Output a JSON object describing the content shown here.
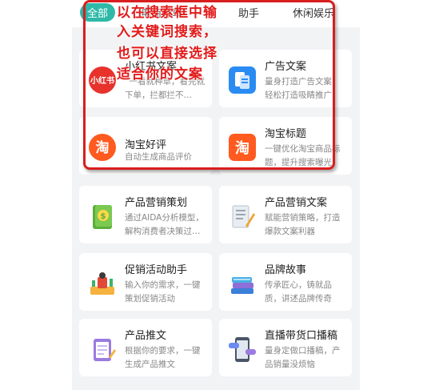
{
  "tabs": [
    {
      "label": "全部",
      "active": true
    },
    {
      "label": "电商种草",
      "active": false
    },
    {
      "label": "助手",
      "active": false
    },
    {
      "label": "休闲娱乐",
      "active": false
    }
  ],
  "annotation": {
    "lines": [
      "以在搜索框中输",
      "入关键词搜索，",
      "也可以直接选择",
      "适合你的文案"
    ]
  },
  "cards": [
    {
      "title": "小红书文案",
      "desc": "“一看就种草，看完就下单，拦都拦不…",
      "icon": "xiaohongshu-icon",
      "icon_text": "小红书"
    },
    {
      "title": "广告文案",
      "desc": "量身打造广告文案，轻松打造吸睛推广",
      "icon": "document-icon"
    },
    {
      "title": "淘宝好评",
      "desc": "自动生成商品评价",
      "icon": "taobao-icon",
      "icon_text": "淘"
    },
    {
      "title": "淘宝标题",
      "desc": "一键优化淘宝商品标题，提升搜索曝光",
      "icon": "taobao-icon",
      "icon_text": "淘"
    },
    {
      "title": "产品营销策划",
      "desc": "通过AIDA分析模型，解构消费者决策过…",
      "icon": "money-book-icon"
    },
    {
      "title": "产品营销文案",
      "desc": "赋能营销策略，打造爆款文案利器",
      "icon": "script-pen-icon"
    },
    {
      "title": "促销活动助手",
      "desc": "输入你的需求，一键策划促销活动",
      "icon": "promotion-icon"
    },
    {
      "title": "品牌故事",
      "desc": "传承匠心，铸就品质，讲述品牌传奇",
      "icon": "books-icon"
    },
    {
      "title": "产品推文",
      "desc": "根据你的要求，一键生成产品推文",
      "icon": "notepad-icon"
    },
    {
      "title": "直播带货口播稿",
      "desc": "量身定做口播稿，产品销量没烦恼",
      "icon": "phone-chat-icon"
    }
  ],
  "colors": {
    "accent": "#2fb8a8",
    "annotation_red": "#e21b1b",
    "xiaohongshu_red": "#e8322c",
    "taobao_orange": "#ff5a1f",
    "doc_blue": "#2a8cf3"
  }
}
